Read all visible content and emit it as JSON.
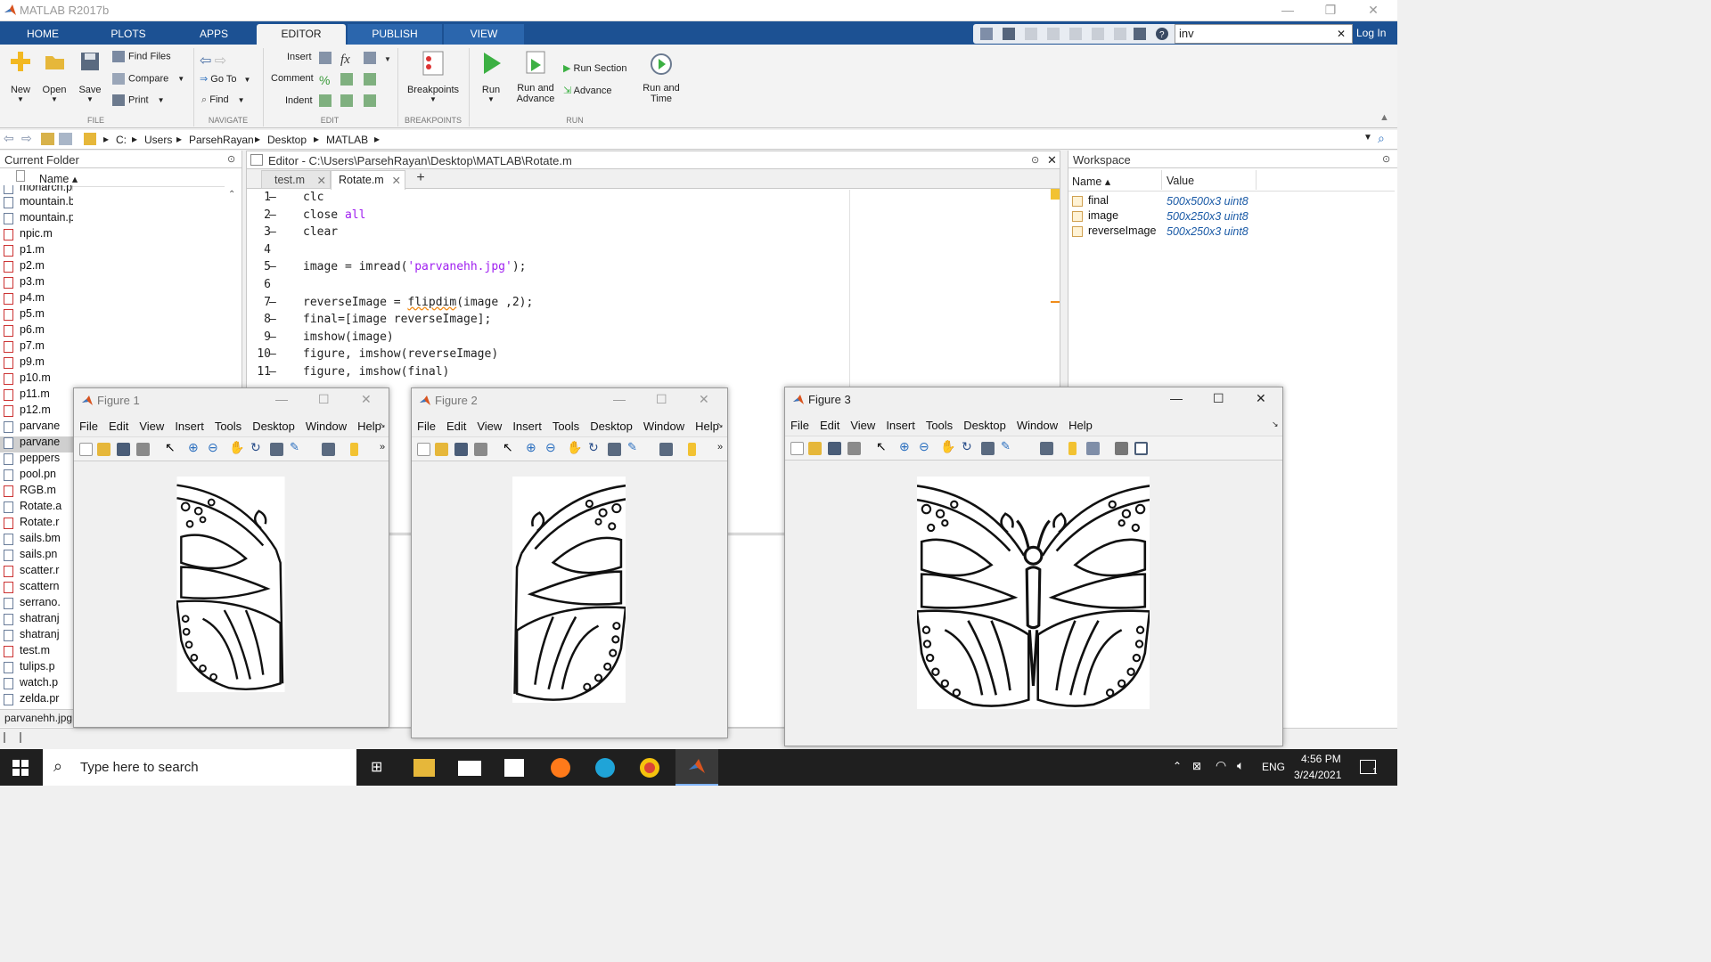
{
  "app": {
    "title": "MATLAB R2017b"
  },
  "tabs": [
    {
      "label": "HOME"
    },
    {
      "label": "PLOTS"
    },
    {
      "label": "APPS"
    },
    {
      "label": "EDITOR"
    },
    {
      "label": "PUBLISH"
    },
    {
      "label": "VIEW"
    }
  ],
  "search": {
    "value": "inv",
    "close": "✕"
  },
  "login": "Log In",
  "ribbon": {
    "file": {
      "label": "FILE",
      "new": "New",
      "open": "Open",
      "save": "Save",
      "find_files": "Find Files",
      "compare": "Compare",
      "print": "Print"
    },
    "navigate": {
      "label": "NAVIGATE",
      "goto": "Go To",
      "find": "Find"
    },
    "edit": {
      "label": "EDIT",
      "insert": "Insert",
      "comment": "Comment",
      "indent": "Indent"
    },
    "breakpoints": {
      "label": "BREAKPOINTS",
      "button": "Breakpoints"
    },
    "run": {
      "label": "RUN",
      "run": "Run",
      "run_advance_1": "Run and",
      "run_advance_2": "Advance",
      "run_section": "Run Section",
      "advance": "Advance",
      "run_time_1": "Run and",
      "run_time_2": "Time"
    }
  },
  "address": {
    "segments": [
      "C:",
      "Users",
      "ParsehRayan",
      "Desktop",
      "MATLAB"
    ]
  },
  "current_folder": {
    "title": "Current Folder",
    "column": "Name ▴",
    "files": [
      "monarch.png",
      "mountain.bmp",
      "mountain.png",
      "npic.m",
      "p1.m",
      "p2.m",
      "p3.m",
      "p4.m",
      "p5.m",
      "p6.m",
      "p7.m",
      "p9.m",
      "p10.m",
      "p11.m",
      "p12.m",
      "parvane",
      "parvane",
      "peppers",
      "pool.pn",
      "RGB.m",
      "Rotate.a",
      "Rotate.r",
      "sails.bm",
      "sails.pn",
      "scatter.r",
      "scattern",
      "serrano.",
      "shatranj",
      "shatranj",
      "test.m",
      "tulips.p",
      "watch.p",
      "zelda.pr"
    ],
    "selected": "parvanehh.jpg"
  },
  "editor": {
    "title": "Editor - C:\\Users\\ParsehRayan\\Desktop\\MATLAB\\Rotate.m",
    "tabs": [
      "test.m",
      "Rotate.m"
    ],
    "add": "+",
    "lines": [
      {
        "n": "1",
        "dash": "–",
        "code": "clc"
      },
      {
        "n": "2",
        "dash": "–",
        "code": "close all"
      },
      {
        "n": "3",
        "dash": "–",
        "code": "clear"
      },
      {
        "n": "4",
        "dash": "",
        "code": ""
      },
      {
        "n": "5",
        "dash": "–",
        "code": "image = imread('parvanehh.jpg');"
      },
      {
        "n": "6",
        "dash": "",
        "code": ""
      },
      {
        "n": "7",
        "dash": "–",
        "code": "reverseImage = flipdim(image ,2);"
      },
      {
        "n": "8",
        "dash": "–",
        "code": "final=[image reverseImage];"
      },
      {
        "n": "9",
        "dash": "–",
        "code": "imshow(image)"
      },
      {
        "n": "10",
        "dash": "–",
        "code": "figure, imshow(reverseImage)"
      },
      {
        "n": "11",
        "dash": "–",
        "code": "figure, imshow(final)"
      }
    ]
  },
  "workspace": {
    "title": "Workspace",
    "col_name": "Name ▴",
    "col_value": "Value",
    "vars": [
      {
        "name": "final",
        "value": "500x500x3 uint8"
      },
      {
        "name": "image",
        "value": "500x250x3 uint8"
      },
      {
        "name": "reverseImage",
        "value": "500x250x3 uint8"
      }
    ]
  },
  "figure_menu": [
    "File",
    "Edit",
    "View",
    "Insert",
    "Tools",
    "Desktop",
    "Window",
    "Help"
  ],
  "figures": [
    {
      "title": "Figure 1"
    },
    {
      "title": "Figure 2"
    },
    {
      "title": "Figure 3"
    }
  ],
  "taskbar": {
    "search_placeholder": "Type here to search",
    "lang": "ENG",
    "time": "4:56 PM",
    "date": "3/24/2021",
    "notif": "1"
  },
  "colors": {
    "tabbar": "#1c5193",
    "string": "#a020f0",
    "keyword_all": "#a020f0"
  }
}
